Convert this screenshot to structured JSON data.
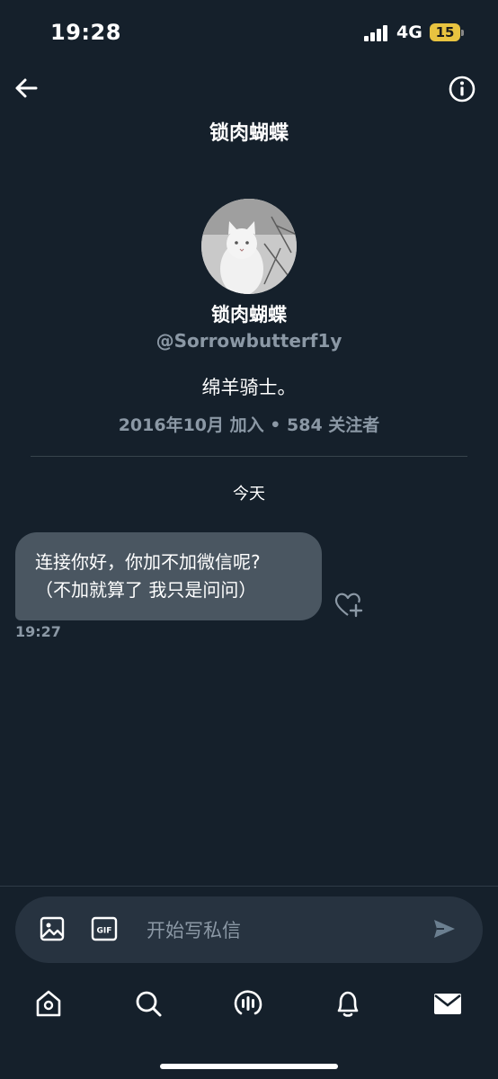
{
  "status_bar": {
    "time": "19:28",
    "network": "4G",
    "battery": "15"
  },
  "header": {
    "title": "锁肉蝴蝶"
  },
  "profile": {
    "name": "锁肉蝴蝶",
    "handle": "@Sorrowbutterf1y",
    "bio": "绵羊骑士。",
    "meta": "2016年10月 加入 • 584 关注者"
  },
  "conversation": {
    "day_label": "今天",
    "messages": [
      {
        "lines": [
          "连接你好，你加不加微信呢?",
          "（不加就算了 我只是问问）"
        ],
        "time": "19:27"
      }
    ]
  },
  "composer": {
    "placeholder": "开始写私信"
  },
  "icons": {
    "back": "back-arrow-icon",
    "info": "info-icon",
    "react": "heart-plus-icon",
    "image": "image-icon",
    "gif": "gif-icon",
    "send": "send-icon",
    "nav": [
      "home-icon",
      "search-icon",
      "spaces-icon",
      "notifications-icon",
      "messages-icon"
    ]
  },
  "colors": {
    "background": "#15202b",
    "bubble": "#4a5661",
    "muted": "#8b98a5",
    "battery": "#e8c340"
  }
}
